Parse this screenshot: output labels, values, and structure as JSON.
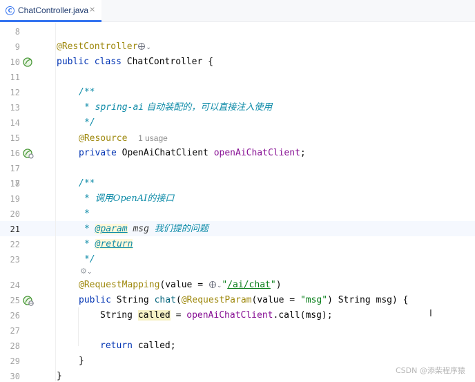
{
  "tab": {
    "label": "ChatController.java",
    "icon": "java-class-icon",
    "close": "×",
    "type_letter": "C"
  },
  "gutter": {
    "lines": [
      "8",
      "9",
      "10",
      "11",
      "12",
      "13",
      "14",
      "15",
      "16",
      "17",
      "18",
      "19",
      "20",
      "21",
      "22",
      "23",
      "24",
      "25",
      "26",
      "27",
      "28",
      "29",
      "30"
    ],
    "current_line": "21"
  },
  "code": {
    "l9": {
      "annotation": "@RestController"
    },
    "l10": {
      "kw1": "public",
      "kw2": "class",
      "name": "ChatController",
      "brace": " {"
    },
    "l12": {
      "doc": "/**"
    },
    "l13": {
      "star": "* ",
      "tag": "spring-ai",
      "text": " 自动装配的，可以直接注入使用"
    },
    "l14": {
      "doc": "*/"
    },
    "l15": {
      "annotation": "@Resource",
      "hint": "1 usage"
    },
    "l16": {
      "kw": "private",
      "type": " OpenAiChatClient ",
      "field": "openAiChatClient",
      "end": ";"
    },
    "l18": {
      "doc": "/**"
    },
    "l19": {
      "star": "* ",
      "text": "调用OpenAI的接口"
    },
    "l20": {
      "star": "*"
    },
    "l21": {
      "star": "* ",
      "tag": "@param",
      "param": " msg ",
      "text": "我们提的问题"
    },
    "l22": {
      "star": "* ",
      "tag": "@return"
    },
    "l23": {
      "doc": "*/"
    },
    "l24": {
      "annotation": "@RequestMapping",
      "open": "(value = ",
      "url": "/ai/chat",
      "close": ")"
    },
    "l25": {
      "kw": "public",
      "type": " String ",
      "method": "chat",
      "open": "(",
      "annotation": "@RequestParam",
      "p1": "(value = ",
      "str": "\"msg\"",
      "p2": ") String msg) {"
    },
    "l26": {
      "type": "String ",
      "var": "called",
      "eq": " = ",
      "field": "openAiChatClient",
      "call": ".call(msg);"
    },
    "l28": {
      "kw": "return",
      "rest": " called;"
    },
    "l29": {
      "brace": "}"
    },
    "l30": {
      "brace": "}"
    }
  },
  "watermark": "CSDN @添柴程序猿"
}
